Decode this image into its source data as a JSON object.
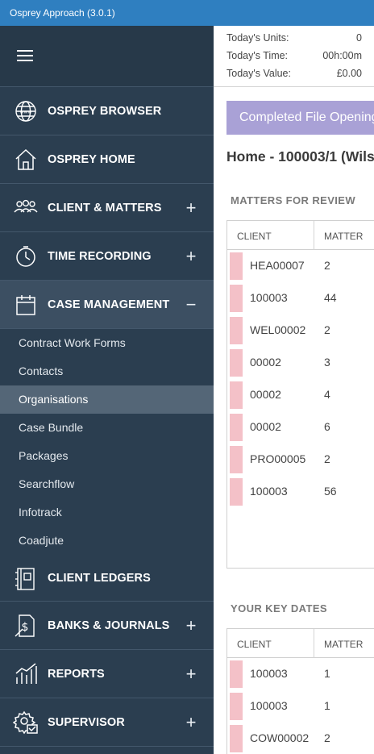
{
  "window": {
    "title": "Osprey Approach (3.0.1)"
  },
  "sidebar": {
    "nav_items": [
      {
        "label": "OSPREY BROWSER",
        "toggle": ""
      },
      {
        "label": "OSPREY HOME",
        "toggle": ""
      },
      {
        "label": "CLIENT & MATTERS",
        "toggle": "+"
      },
      {
        "label": "TIME RECORDING",
        "toggle": "+"
      },
      {
        "label": "CASE MANAGEMENT",
        "toggle": "−"
      }
    ],
    "case_management_items": [
      "Contract Work Forms",
      "Contacts",
      "Organisations",
      "Case Bundle",
      "Packages",
      "Searchflow",
      "Infotrack",
      "Coadjute"
    ],
    "selected_sub_item": "Organisations",
    "lower_items": [
      {
        "label": "CLIENT LEDGERS",
        "toggle": ""
      },
      {
        "label": "BANKS & JOURNALS",
        "toggle": "+"
      },
      {
        "label": "REPORTS",
        "toggle": "+"
      },
      {
        "label": "SUPERVISOR",
        "toggle": "+"
      }
    ]
  },
  "stats": {
    "units_label": "Today's Units:",
    "units_value": "0",
    "time_label": "Today's Time:",
    "time_value": "00h:00m",
    "value_label": "Today's Value:",
    "value_value": "£0.00"
  },
  "banner": {
    "text": "Completed File Opening"
  },
  "home_title": "Home - 100003/1 (Wils",
  "matters_for_review": {
    "title": "MATTERS FOR REVIEW",
    "columns": [
      "CLIENT",
      "MATTER"
    ],
    "rows": [
      [
        "HEA00007",
        "2"
      ],
      [
        "100003",
        "44"
      ],
      [
        "WEL00002",
        "2"
      ],
      [
        "00002",
        "3"
      ],
      [
        "00002",
        "4"
      ],
      [
        "00002",
        "6"
      ],
      [
        "PRO00005",
        "2"
      ],
      [
        "100003",
        "56"
      ]
    ]
  },
  "key_dates": {
    "title": "YOUR KEY DATES",
    "columns": [
      "CLIENT",
      "MATTER"
    ],
    "rows": [
      [
        "100003",
        "1"
      ],
      [
        "100003",
        "1"
      ],
      [
        "COW00002",
        "2"
      ]
    ]
  },
  "colors": {
    "sidebar": "#2b3e50",
    "titlebar": "#2f7fc0",
    "banner": "#a9a1d6",
    "flag": "#f4c1c8"
  }
}
